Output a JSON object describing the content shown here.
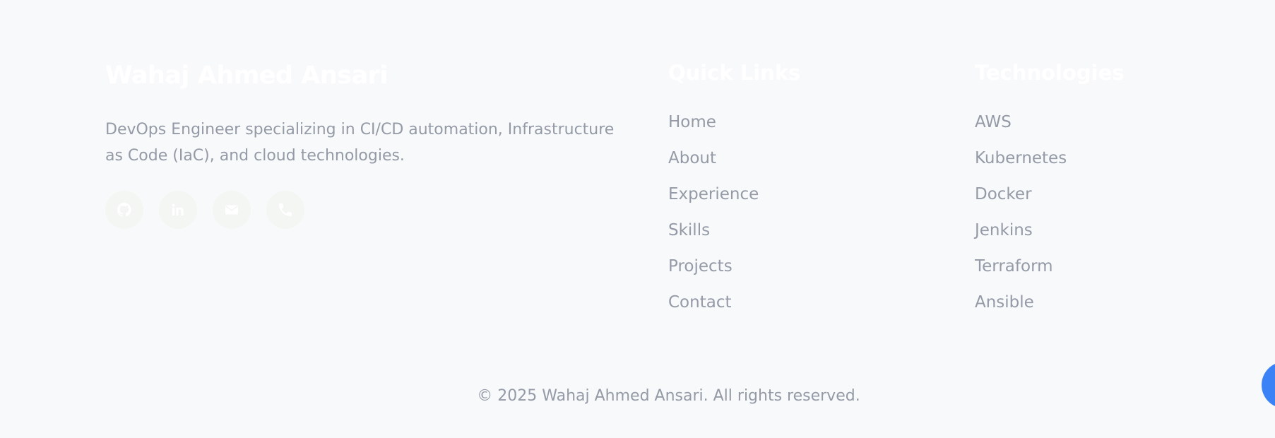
{
  "brand": {
    "name": "Wahaj Ahmed Ansari",
    "description": "DevOps Engineer specializing in CI/CD automation, Infrastructure as Code (IaC), and cloud technologies.",
    "socials": [
      {
        "icon": "github-icon"
      },
      {
        "icon": "linkedin-icon"
      },
      {
        "icon": "mail-icon"
      },
      {
        "icon": "phone-icon"
      }
    ]
  },
  "quick_links": {
    "heading": "Quick Links",
    "items": [
      "Home",
      "About",
      "Experience",
      "Skills",
      "Projects",
      "Contact"
    ]
  },
  "technologies": {
    "heading": "Technologies",
    "items": [
      "AWS",
      "Kubernetes",
      "Docker",
      "Jenkins",
      "Terraform",
      "Ansible"
    ]
  },
  "copyright": "© 2025 Wahaj Ahmed Ansari. All rights reserved.",
  "colors": {
    "background": "#f8f9fb",
    "muted_text": "#949aa6",
    "heading_text": "#ffffff",
    "accent": "#3b82f6"
  }
}
